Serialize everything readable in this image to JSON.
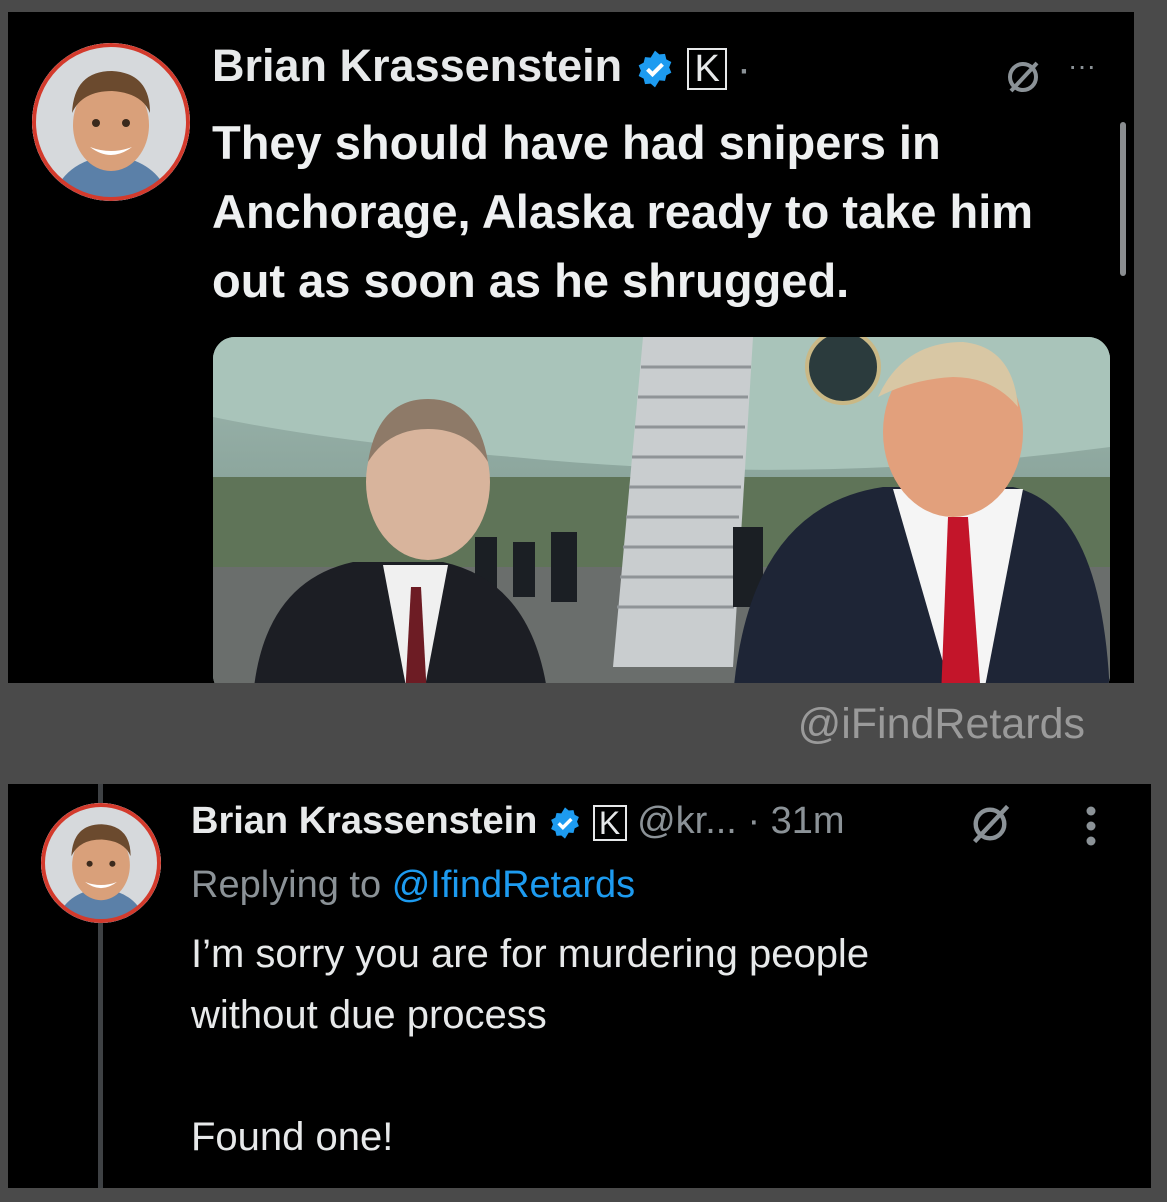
{
  "tweet1": {
    "author": "Brian Krassenstein",
    "separator": "·",
    "text": "They should have had snipers in Anchorage, Alaska ready to take him out as soon as he shrugged.",
    "more": "···",
    "icons": {
      "avatar": "avatar-photo",
      "verified": "verified-badge-icon",
      "affiliate": "k-badge-icon",
      "grok": "grok-icon"
    }
  },
  "watermark": "@iFindRetards",
  "tweet2": {
    "author": "Brian Krassenstein",
    "handle": "@kr...",
    "time": "· 31m",
    "replying_prefix": "Replying to",
    "replying_handle": "@IfindRetards",
    "text": "I’m sorry you are for murdering people\nwithout due process\n\nFound one!",
    "icons": {
      "more": "vertical-ellipsis-icon"
    }
  },
  "colors": {
    "accent": "#1d9bf0",
    "avatar_ring": "#d33a2c",
    "background": "#000000",
    "frame": "#4a4a4a"
  }
}
